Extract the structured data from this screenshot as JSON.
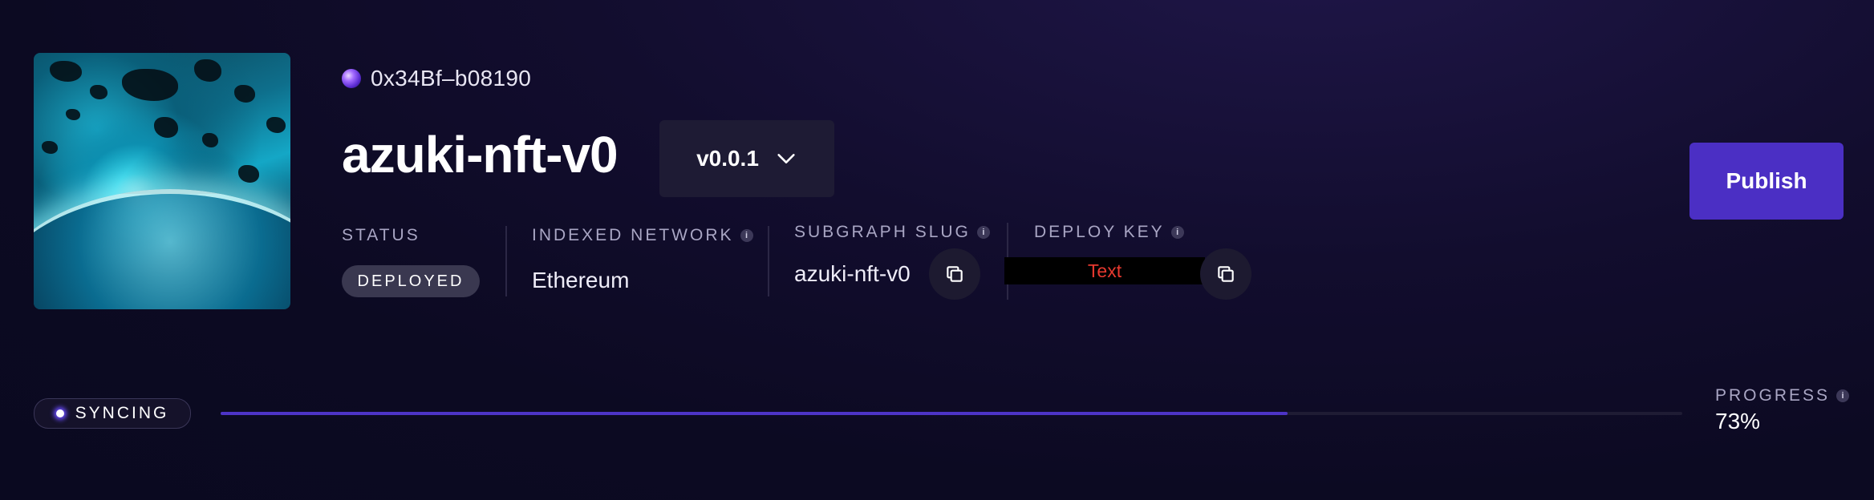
{
  "owner": {
    "address": "0x34Bf–b08190",
    "avatar_icon": "purple-orb-avatar"
  },
  "subgraph": {
    "name": "azuki-nft-v0",
    "version": "v0.0.1"
  },
  "status": {
    "label": "STATUS",
    "value": "DEPLOYED"
  },
  "network": {
    "label": "INDEXED NETWORK",
    "value": "Ethereum"
  },
  "slug": {
    "label": "SUBGRAPH SLUG",
    "value": "azuki-nft-v0"
  },
  "deploy_key": {
    "label": "DEPLOY KEY",
    "value": "Text"
  },
  "actions": {
    "publish_label": "Publish"
  },
  "sync": {
    "status_label": "SYNCING",
    "progress_label": "PROGRESS",
    "progress_text": "73%",
    "progress_fraction": 0.73
  },
  "colors": {
    "accent": "#4b2fc4",
    "background": "#0c0a22",
    "redacted_text": "#e8392f"
  }
}
